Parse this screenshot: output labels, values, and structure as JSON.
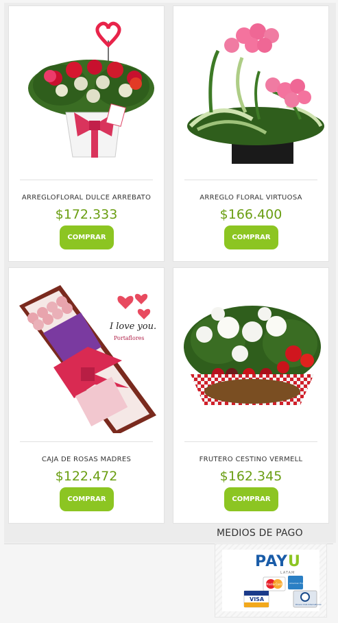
{
  "products": [
    {
      "name": "ARREGLOFLORAL DULCE ARREBATO",
      "price": "$172.333",
      "button": "COMPRAR",
      "image_icon": "flower-arrangement-heart-icon"
    },
    {
      "name": "ARREGLO FLORAL VIRTUOSA",
      "price": "$166.400",
      "button": "COMPRAR",
      "image_icon": "pink-roses-arrangement-icon"
    },
    {
      "name": "CAJA DE ROSAS MADRES",
      "price": "$122.472",
      "button": "COMPRAR",
      "image_icon": "rose-box-icon"
    },
    {
      "name": "FRUTERO CESTINO VERMELL",
      "price": "$162.345",
      "button": "COMPRAR",
      "image_icon": "fruit-basket-icon"
    }
  ],
  "payment": {
    "title": "MEDIOS DE PAGO",
    "provider": "PayU",
    "provider_main": "PAY",
    "provider_accent": "U",
    "region": "LATAM",
    "cards": [
      "MasterCard",
      "American Express",
      "VISA",
      "Diners Club International"
    ]
  },
  "rose_box_text": {
    "line1": "I love you.",
    "brand": "Portaflores"
  },
  "colors": {
    "price": "#6a9e12",
    "button": "#8cc522",
    "payu_blue": "#1a5ca8"
  }
}
